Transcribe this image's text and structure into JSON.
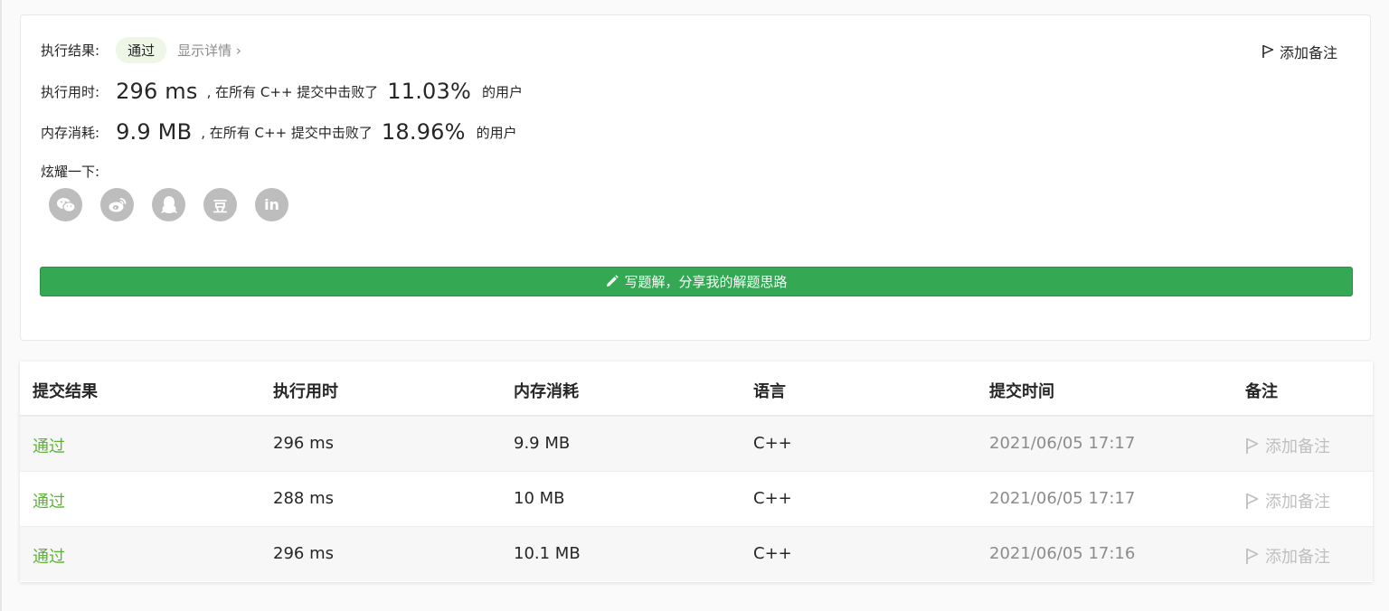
{
  "result": {
    "label": "执行结果:",
    "status": "通过",
    "details_link": "显示详情 ›",
    "add_note": "添加备注"
  },
  "runtime": {
    "label": "执行用时:",
    "value": "296 ms",
    "mid_text": ", 在所有 C++ 提交中击败了",
    "percent": "11.03%",
    "suffix": "的用户"
  },
  "memory": {
    "label": "内存消耗:",
    "value": "9.9 MB",
    "mid_text": ", 在所有 C++ 提交中击败了",
    "percent": "18.96%",
    "suffix": "的用户"
  },
  "share": {
    "label": "炫耀一下:",
    "icons": [
      "wechat-icon",
      "weibo-icon",
      "qq-icon",
      "douban-icon",
      "linkedin-icon"
    ],
    "douban_glyph": "豆",
    "linkedin_glyph": "in"
  },
  "solution_button": "写题解，分享我的解题思路",
  "table": {
    "headers": [
      "提交结果",
      "执行用时",
      "内存消耗",
      "语言",
      "提交时间",
      "备注"
    ],
    "rows": [
      {
        "status": "通过",
        "runtime": "296 ms",
        "memory": "9.9 MB",
        "lang": "C++",
        "time": "2021/06/05 17:17",
        "note": "添加备注"
      },
      {
        "status": "通过",
        "runtime": "288 ms",
        "memory": "10 MB",
        "lang": "C++",
        "time": "2021/06/05 17:17",
        "note": "添加备注"
      },
      {
        "status": "通过",
        "runtime": "296 ms",
        "memory": "10.1 MB",
        "lang": "C++",
        "time": "2021/06/05 17:16",
        "note": "添加备注"
      }
    ]
  },
  "colors": {
    "accent_green": "#34a853",
    "status_green": "#5cb335",
    "muted": "#8c8c8c",
    "icon_gray": "#bdbdbd"
  }
}
